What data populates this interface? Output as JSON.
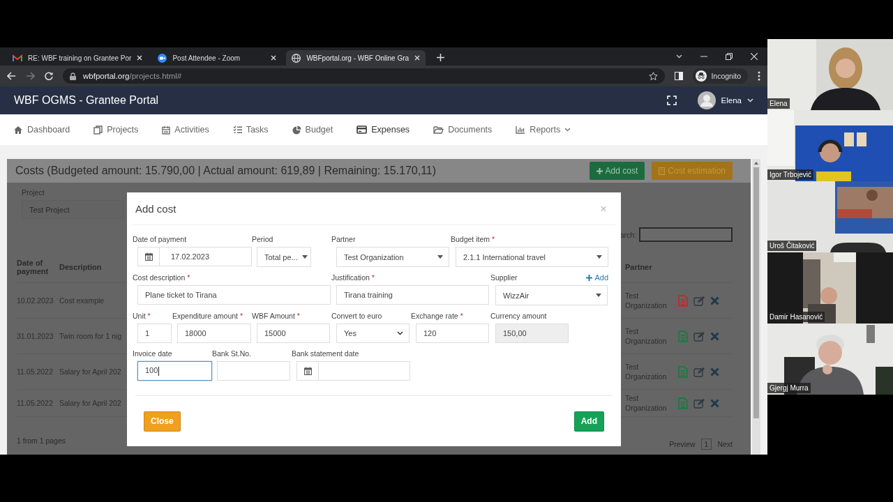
{
  "browser": {
    "tabs": [
      {
        "title": "RE: WBF training on Grantee Por",
        "selected": false
      },
      {
        "title": "Post Attendee - Zoom",
        "selected": false
      },
      {
        "title": "WBFportal.org - WBF Online Gra",
        "selected": true
      }
    ],
    "url_host": "wbfportal.org",
    "url_path": "/projects.html#",
    "profile": "Incognito"
  },
  "app": {
    "title": "WBF OGMS - Grantee Portal",
    "user": "Elena",
    "nav": [
      {
        "label": "Dashboard",
        "selected": false
      },
      {
        "label": "Projects",
        "selected": false
      },
      {
        "label": "Activities",
        "selected": false
      },
      {
        "label": "Tasks",
        "selected": false
      },
      {
        "label": "Budget",
        "selected": false
      },
      {
        "label": "Expenses",
        "selected": true
      },
      {
        "label": "Documents",
        "selected": false
      },
      {
        "label": "Reports",
        "selected": false,
        "dropdown": true
      }
    ]
  },
  "costs": {
    "title": "Costs (Budgeted amount: 15.790,00 | Actual amount: 619,89 | Remaining: 15.170,11)",
    "buttons": [
      {
        "label": "Add cost",
        "kind": "add"
      },
      {
        "label": "Cost estimation",
        "kind": "estimate"
      }
    ],
    "project_label": "Project",
    "project": "Test Project",
    "search_label": "arch:",
    "columns": [
      "Date of payment",
      "Description",
      "Partner"
    ],
    "rows": [
      {
        "date": "10.02.2023",
        "description": "Cost example",
        "partner": "Test Organization",
        "color": "#b03434"
      },
      {
        "date": "31.01.2023",
        "description": "Twin room for 1 nig",
        "partner": "Test Organization",
        "color": "#1f7a45"
      },
      {
        "date": "11.05.2022",
        "description": "Salary for April 202",
        "partner": "Test Organization",
        "color": "#1f7a45"
      },
      {
        "date": "11.05.2022",
        "description": "Salary for April 202",
        "partner": "Test Organization",
        "color": "#1f7a45"
      }
    ],
    "pager_info": "1 from 1 pages",
    "pager": {
      "prev": "Preview",
      "page": "1",
      "next": "Next"
    }
  },
  "modal": {
    "title": "Add cost",
    "close": "×",
    "rows": [
      {
        "fields": [
          {
            "label": "Date of payment",
            "kind": "date",
            "value": "17.02.2023",
            "focused": false
          },
          {
            "label": "Period",
            "kind": "select",
            "value": "Total pe...",
            "focused": false
          },
          {
            "label": "Partner",
            "kind": "select",
            "value": "Test Organization",
            "focused": false
          },
          {
            "label": "Budget item",
            "mark": "*",
            "kind": "select",
            "value": "2.1.1 International travel",
            "focused": false
          }
        ]
      },
      {
        "fields": [
          {
            "label": "Cost description",
            "mark": "*",
            "kind": "text",
            "value": "Plane ticket to Tirana",
            "focused": false
          },
          {
            "label": "Justification",
            "mark": "*",
            "kind": "text",
            "value": "Tirana training",
            "focused": false
          },
          {
            "label": "Supplier",
            "action": "Add",
            "kind": "select",
            "value": "WizzAir",
            "focused": false
          }
        ]
      },
      {
        "fields": [
          {
            "label": "Unit",
            "mark": "*",
            "kind": "text",
            "value": "1",
            "focused": false
          },
          {
            "label": "Expenditure amount",
            "mark": "*",
            "kind": "text",
            "value": "18000",
            "focused": false
          },
          {
            "label": "WBF Amount",
            "mark": "*",
            "kind": "text",
            "value": "15000",
            "focused": false
          },
          {
            "label": "Convert to euro",
            "kind": "native-select",
            "value": "Yes",
            "focused": false
          },
          {
            "label": "Exchange rate",
            "mark": "*",
            "kind": "text",
            "value": "120",
            "focused": false
          },
          {
            "label": "Currency amount",
            "kind": "readonly",
            "value": "150,00",
            "focused": false
          }
        ]
      },
      {
        "fields": [
          {
            "label": "Invoice date",
            "kind": "text",
            "value": "100",
            "focused": true
          },
          {
            "label": "Bank St.No.",
            "kind": "text",
            "focused": false
          },
          {
            "label": "Bank statement date",
            "kind": "date",
            "focused": false
          }
        ]
      }
    ],
    "buttons": [
      {
        "label": "Close",
        "kind": "close"
      },
      {
        "label": "Add",
        "kind": "add"
      }
    ]
  },
  "participants": [
    {
      "name": "Elena"
    },
    {
      "name": "Igor Trbojević"
    },
    {
      "name": "Uroš Čitaković"
    },
    {
      "name": "Damir Hasanović"
    },
    {
      "name": "Gjergj Murra"
    }
  ]
}
